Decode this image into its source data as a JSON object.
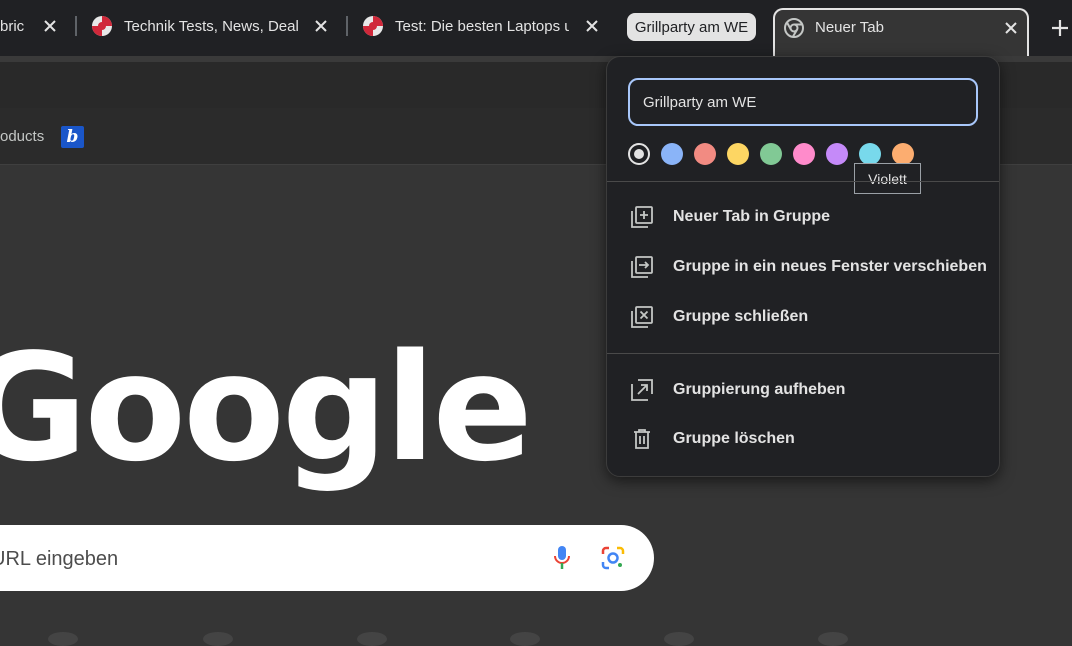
{
  "tabs": [
    {
      "title": "bric",
      "has_close": true
    },
    {
      "title": "Technik Tests, News, Deals",
      "has_close": true
    },
    {
      "title": "Test: Die besten Laptops u",
      "has_close": true
    }
  ],
  "group": {
    "label": "Grillparty am WE"
  },
  "active_tab": {
    "title": "Neuer Tab"
  },
  "bookmarks": {
    "partial_label": "oducts",
    "icon_letter": "b"
  },
  "logo": {
    "text": "Google"
  },
  "search": {
    "placeholder": "URL eingeben"
  },
  "popup": {
    "name_value": "Grillparty am WE",
    "colors": [
      {
        "name": "grey",
        "hex": "#e3e3e3",
        "selected": true
      },
      {
        "name": "blue",
        "hex": "#8ab4f8"
      },
      {
        "name": "red",
        "hex": "#f28b82"
      },
      {
        "name": "yellow",
        "hex": "#fdd663"
      },
      {
        "name": "green",
        "hex": "#81c995"
      },
      {
        "name": "pink",
        "hex": "#ff8bcb"
      },
      {
        "name": "purple",
        "hex": "#c58af9"
      },
      {
        "name": "cyan",
        "hex": "#78d9ec"
      },
      {
        "name": "orange",
        "hex": "#fcad70"
      }
    ],
    "tooltip": "Violett",
    "menu": [
      {
        "label": "Neuer Tab in Gruppe",
        "icon": "add-to-group-icon"
      },
      {
        "label": "Gruppe in ein neues Fenster verschieben",
        "icon": "move-to-window-icon"
      },
      {
        "label": "Gruppe schließen",
        "icon": "close-group-icon"
      },
      {
        "label": "Gruppierung aufheben",
        "icon": "ungroup-icon"
      },
      {
        "label": "Gruppe löschen",
        "icon": "trash-icon"
      }
    ]
  }
}
